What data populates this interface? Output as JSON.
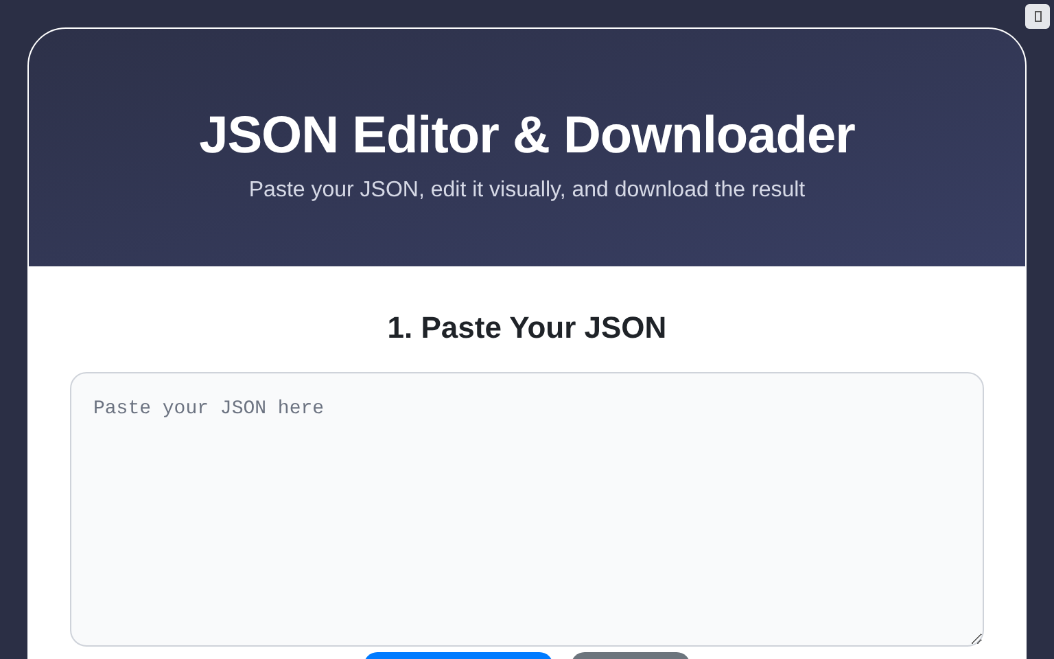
{
  "header": {
    "title": "JSON Editor & Downloader",
    "subtitle": "Paste your JSON, edit it visually, and download the result"
  },
  "section": {
    "heading": "1. Paste Your JSON",
    "input": {
      "placeholder": "Paste your JSON here"
    }
  },
  "buttons": [
    {
      "kind": "primary"
    },
    {
      "kind": "secondary"
    }
  ]
}
